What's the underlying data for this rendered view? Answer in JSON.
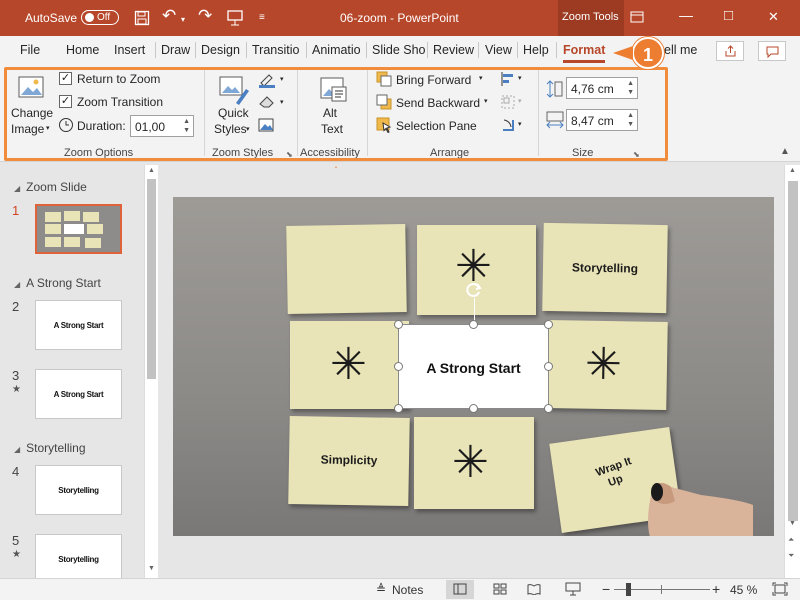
{
  "titlebar": {
    "autosave_label": "AutoSave",
    "autosave_state": "Off",
    "doc_title": "06-zoom  -  PowerPoint",
    "contextual_tab": "Zoom Tools",
    "window_minimize": "—",
    "window_maximize": "□",
    "window_close": "✕"
  },
  "menu": {
    "items": [
      "File",
      "Home",
      "Insert",
      "Draw",
      "Design",
      "Transitio",
      "Animatio",
      "Slide Sho",
      "Review",
      "View",
      "Help",
      "Format"
    ],
    "active": "Format",
    "tell_me": "ell me"
  },
  "ribbon": {
    "change_image_line1": "Change",
    "change_image_line2": "Image",
    "return_to_zoom": "Return to Zoom",
    "zoom_transition": "Zoom Transition",
    "duration_label": "Duration:",
    "duration_value": "01,00",
    "group_zoom_options": "Zoom Options",
    "quick_styles_line1": "Quick",
    "quick_styles_line2": "Styles",
    "group_zoom_styles": "Zoom Styles",
    "alt_text_line1": "Alt",
    "alt_text_line2": "Text",
    "group_accessibility": "Accessibility",
    "bring_forward": "Bring Forward",
    "send_backward": "Send Backward",
    "selection_pane": "Selection Pane",
    "group_arrange": "Arrange",
    "height_value": "4,76 cm",
    "width_value": "8,47 cm",
    "group_size": "Size"
  },
  "callouts": {
    "one": "1",
    "two": "2"
  },
  "slides_pane": {
    "sections": [
      "Zoom Slide",
      "A Strong Start",
      "Storytelling"
    ],
    "slides": [
      {
        "num": "1",
        "title": ""
      },
      {
        "num": "2",
        "title": "A Strong Start"
      },
      {
        "num": "3",
        "title": "A Strong Start"
      },
      {
        "num": "4",
        "title": "Storytelling"
      },
      {
        "num": "5",
        "title": "Storytelling"
      }
    ]
  },
  "slide": {
    "note_storytelling": "Storytelling",
    "note_center": "A Strong Start",
    "note_simplicity": "Simplicity",
    "note_wrap_line1": "Wrap It",
    "note_wrap_line2": "Up",
    "asterisk": "✳"
  },
  "status": {
    "notes_label": "Notes",
    "zoom_percent": "45 %"
  },
  "colors": {
    "accent": "#b7472a",
    "callout": "#ed7d31",
    "note": "#e9e4b7"
  }
}
